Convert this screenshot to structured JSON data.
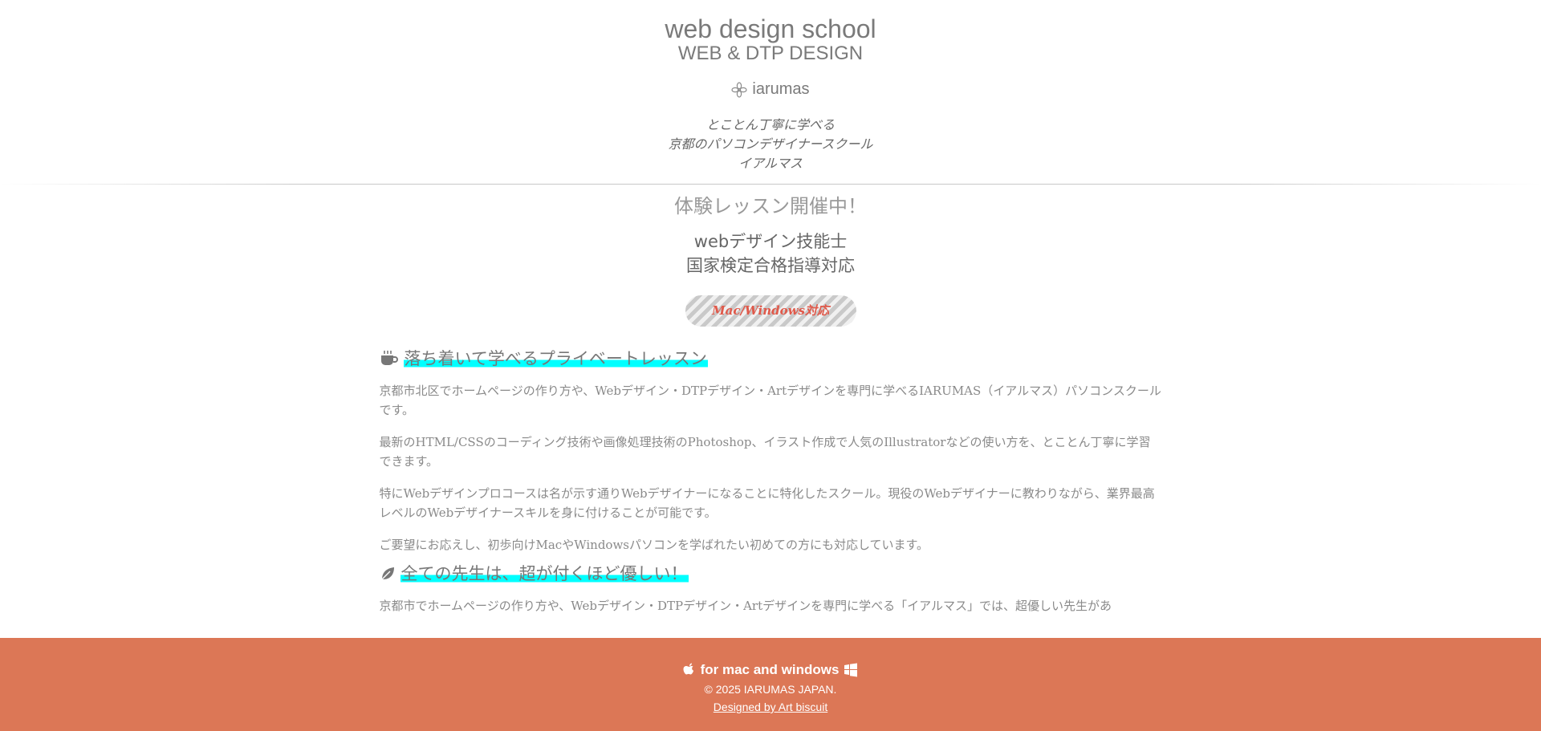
{
  "header": {
    "title": "web design school",
    "subtitle": "WEB & DTP DESIGN",
    "brand": "iarumas",
    "tagline": [
      "とことん丁寧に学べる",
      "京都のパソコンデザイナースクール",
      "イアルマス"
    ]
  },
  "hero": {
    "trial": "体験レッスン開催中！",
    "cert_line1": "webデザイン技能士",
    "cert_line2": "国家検定合格指導対応",
    "badge": "Mac/Windows対応"
  },
  "sections": [
    {
      "icon": "coffee-cup-icon",
      "heading": "落ち着いて学べるプライベートレッスン",
      "paragraphs": [
        "京都市北区でホームページの作り方や、Webデザイン・DTPデザイン・Artデザインを専門に学べるIARUMAS（イアルマス）パソコンスクールです。",
        "最新のHTML/CSSのコーディング技術や画像処理技術のPhotoshop、イラスト作成で人気のIllustratorなどの使い方を、とことん丁寧に学習できます。",
        "特にWebデザインプロコースは名が示す通りWebデザイナーになることに特化したスクール。現役のWebデザイナーに教わりながら、業界最高レベルのWebデザイナースキルを身に付けることが可能です。",
        "ご要望にお応えし、初歩向けMacやWindowsパソコンを学ばれたい初めての方にも対応しています。"
      ]
    },
    {
      "icon": "leaf-icon",
      "heading": "全ての先生は、超が付くほど優しい！",
      "paragraphs": [
        "京都市でホームページの作り方や、Webデザイン・DTPデザイン・Artデザインを専門に学べる「イアルマス」では、超優しい先生があ"
      ]
    }
  ],
  "footer": {
    "platforms": "for mac and windows",
    "copyright": "© 2025 IARUMAS JAPAN.",
    "credit": "Designed by Art biscuit"
  },
  "colors": {
    "footer_bg": "#dc7756",
    "highlight": "#00ffff",
    "badge_text": "#e0594a"
  }
}
